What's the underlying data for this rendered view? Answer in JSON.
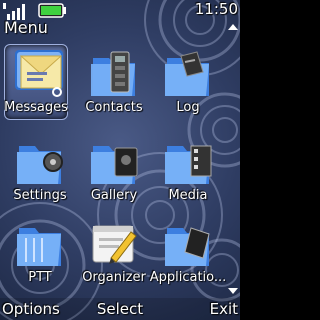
{
  "status": {
    "time": "11:50"
  },
  "screen_title": "Menu",
  "grid": [
    {
      "label": "Messages",
      "icon": "messages-icon",
      "selected": true
    },
    {
      "label": "Contacts",
      "icon": "contacts-icon"
    },
    {
      "label": "Log",
      "icon": "log-icon"
    },
    {
      "label": "Settings",
      "icon": "settings-icon"
    },
    {
      "label": "Gallery",
      "icon": "gallery-icon"
    },
    {
      "label": "Media",
      "icon": "media-icon"
    },
    {
      "label": "PTT",
      "icon": "ptt-icon"
    },
    {
      "label": "Organizer",
      "icon": "organizer-icon"
    },
    {
      "label": "Applicatio...",
      "icon": "applications-icon"
    }
  ],
  "softkeys": {
    "left": "Options",
    "middle": "Select",
    "right": "Exit"
  },
  "colors": {
    "background": "#2f3d63",
    "folder_blue": "#4f8fe6",
    "text": "#ffffff"
  }
}
